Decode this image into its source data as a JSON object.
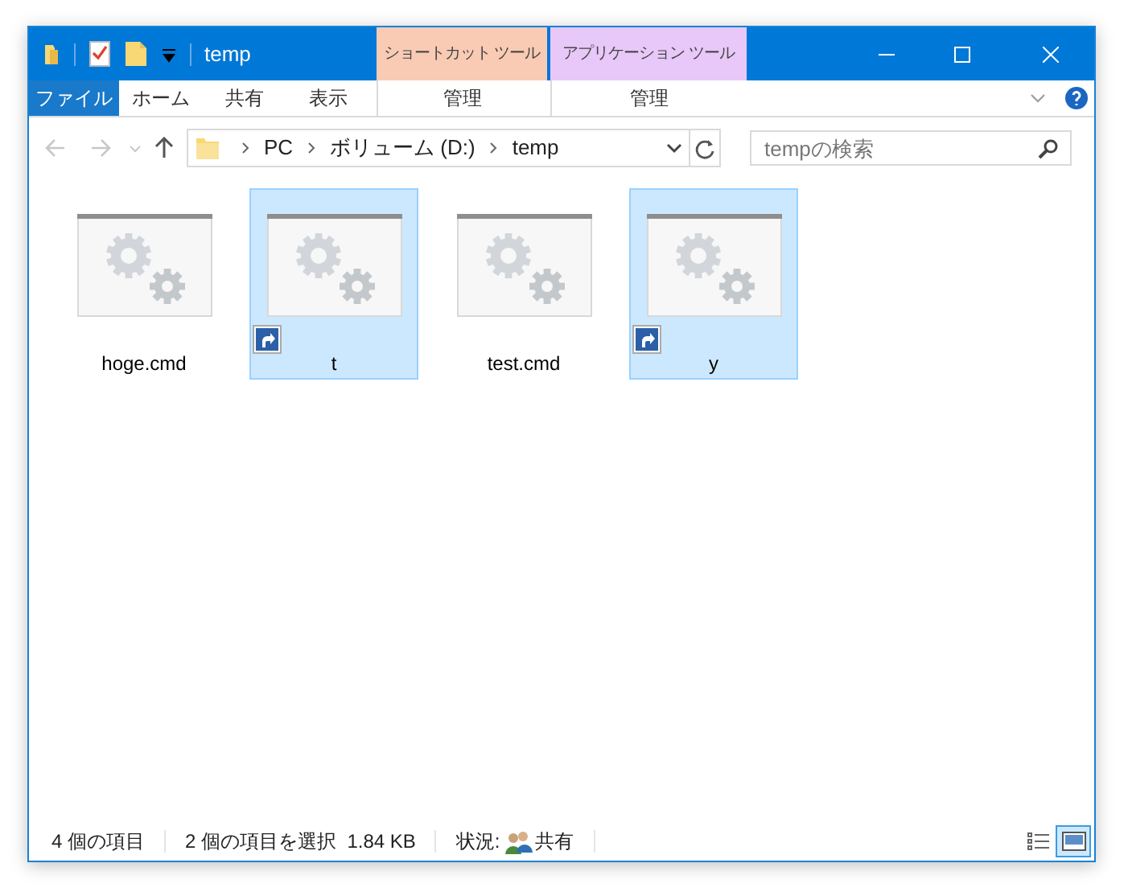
{
  "window": {
    "title": "temp"
  },
  "context_groups": [
    {
      "label": "ショートカット ツール",
      "color": "#f9cbb4",
      "tab": "管理"
    },
    {
      "label": "アプリケーション ツール",
      "color": "#e8c8f8",
      "tab": "管理"
    }
  ],
  "ribbon_tabs": [
    {
      "label": "ファイル",
      "kind": "file"
    },
    {
      "label": "ホーム",
      "kind": "tab"
    },
    {
      "label": "共有",
      "kind": "tab"
    },
    {
      "label": "表示",
      "kind": "tab"
    }
  ],
  "address": {
    "crumbs": [
      "PC",
      "ボリューム (D:)",
      "temp"
    ]
  },
  "search": {
    "placeholder": "tempの検索"
  },
  "items": [
    {
      "name": "hoge.cmd",
      "selected": false,
      "shortcut": false
    },
    {
      "name": "t",
      "selected": true,
      "shortcut": true
    },
    {
      "name": "test.cmd",
      "selected": false,
      "shortcut": false
    },
    {
      "name": "y",
      "selected": true,
      "shortcut": true
    }
  ],
  "status_bar": {
    "count": "4 個の項目",
    "selection": "2 個の項目を選択  1.84 KB",
    "state_label": "状況:",
    "state": "共有"
  },
  "views": [
    {
      "kind": "details",
      "selected": false
    },
    {
      "kind": "large",
      "selected": true
    }
  ]
}
